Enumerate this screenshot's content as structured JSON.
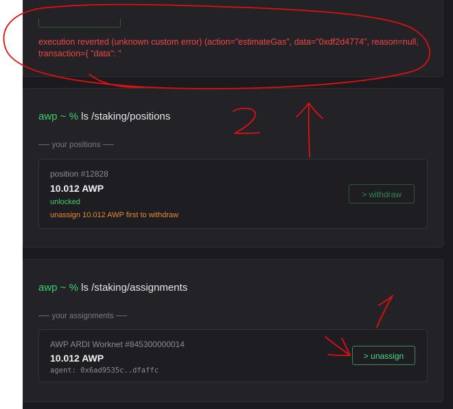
{
  "error": {
    "message": "execution reverted (unknown custom error) (action=\"estimateGas\", data=\"0xdf2d4774\", reason=null, transaction={ \"data\": \""
  },
  "positions_section": {
    "prompt_user": "awp ~ %",
    "prompt_command": "ls /staking/positions",
    "label": "── your positions ──",
    "item": {
      "title": "position #12828",
      "amount": "10.012 AWP",
      "status": "unlocked",
      "warning": "unassign 10.012 AWP first to withdraw",
      "button_label": "> withdraw"
    }
  },
  "assignments_section": {
    "prompt_user": "awp ~ %",
    "prompt_command": "ls /staking/assignments",
    "label": "── your assignments ──",
    "item": {
      "title": "AWP ARDI Worknet #845300000014",
      "amount": "10.012 AWP",
      "agent": "agent: 0x6ad9535c..dfaffc",
      "button_label": "> unassign"
    }
  },
  "colors": {
    "background": "#1b1b1f",
    "card": "#232327",
    "accent_green": "#3ecf6e",
    "error_red": "#f04545",
    "warning_orange": "#e68a2e",
    "annotation_red": "#e01010"
  }
}
